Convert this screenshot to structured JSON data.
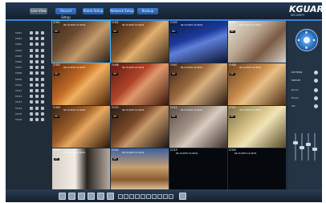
{
  "brand": {
    "logo": "KGUARD",
    "tagline": "SECURITY"
  },
  "tabs": [
    {
      "label": "Live View",
      "active": true
    },
    {
      "label": "Record Setup",
      "active": false
    },
    {
      "label": "Alarm Setup",
      "active": false
    },
    {
      "label": "Network Setup",
      "active": false
    },
    {
      "label": "Backup",
      "active": false
    }
  ],
  "channels": [
    "CH01",
    "CH02",
    "CH03",
    "CH04",
    "CH05",
    "CH06",
    "CH07",
    "CH08",
    "CH09",
    "CH10",
    "CH11",
    "CH12",
    "CH13",
    "CH14",
    "CH15",
    "CH16"
  ],
  "cells": [
    {
      "name": "CH01",
      "time": "06-13-2015 14:40:01",
      "tag": "REC",
      "bg": "linear-gradient(135deg,#3a2a1e 0%,#6b4a30 35%,#c59a6b 60%,#2a1d15 100%)"
    },
    {
      "name": "CH02",
      "time": "06-13-2015 14:40:01",
      "tag": "REC",
      "bg": "linear-gradient(135deg,#2a1a10 0%,#8a5a2e 40%,#e2b070 55%,#3a2414 100%)"
    },
    {
      "name": "CH03",
      "time": "06-13-2015 14:40:01",
      "tag": "REC",
      "bg": "linear-gradient(160deg,#0b1a4a 0%,#1b3a9a 40%,#5f7fd8 55%,#0a1430 100%)"
    },
    {
      "name": "CH04",
      "time": "06-13-2015 14:40:01",
      "tag": "REC",
      "bg": "linear-gradient(135deg,#e8e4dc 0%,#b9a48e 40%,#7a5a44 65%,#d8d2c8 100%)"
    },
    {
      "name": "CH05",
      "time": "06-13-2015 14:40:01",
      "tag": "REC",
      "bg": "linear-gradient(135deg,#5a2a10 0%,#c26a25 40%,#f0b060 55%,#4a2008 100%)"
    },
    {
      "name": "CH06",
      "time": "06-13-2015 14:40:01",
      "tag": "REC",
      "bg": "linear-gradient(135deg,#5a1a10 0%,#b0442a 40%,#e09a6a 55%,#3a120a 100%)"
    },
    {
      "name": "CH07",
      "time": "06-13-2015 14:40:01",
      "tag": "REC",
      "bg": "linear-gradient(135deg,#3a2418 0%,#9a6a3e 40%,#d8b080 55%,#2a1a10 100%)"
    },
    {
      "name": "CH08",
      "time": "06-13-2015 14:40:01",
      "tag": "REC",
      "bg": "linear-gradient(135deg,#6a4020 0%,#c58a4a 40%,#e8c088 55%,#4a2c14 100%)"
    },
    {
      "name": "CH09",
      "time": "06-13-2015 14:40:01",
      "tag": "REC",
      "bg": "linear-gradient(135deg,#3a2010 0%,#a0602a 40%,#e8a860 55%,#2a1608 100%)"
    },
    {
      "name": "CH10",
      "time": "06-13-2015 14:40:01",
      "tag": "REC",
      "bg": "linear-gradient(135deg,#2a1a12 0%,#7a4a2a 40%,#c89a6a 55%,#1e140e 100%)"
    },
    {
      "name": "CH11",
      "time": "06-13-2015 14:40:01",
      "tag": "REC",
      "bg": "linear-gradient(135deg,#5a4a44 0%,#a49488 40%,#d8ccc0 55%,#3a2e28 100%)"
    },
    {
      "name": "CH12",
      "time": "06-13-2015 14:40:01",
      "tag": "REC",
      "bg": "linear-gradient(135deg,#7a6a40 0%,#d8c488 40%,#f0e4b8 55%,#5a4a28 100%)"
    },
    {
      "name": "CH13",
      "time": "06-13-2015 14:40:01",
      "tag": "REC",
      "bg": "linear-gradient(90deg,#d8d0c8 0%,#f2ece4 40%,#2a2420 60%,#b8aca0 100%)"
    },
    {
      "name": "CH14",
      "time": "06-13-2015 14:40:01",
      "tag": "REC",
      "bg": "linear-gradient(180deg,#3a60a0 0%,#c8a070 45%,#8a5a30 75%,#e0c8a0 100%)"
    },
    {
      "name": "CH15",
      "time": "06-13-2015 14:40:01",
      "tag": "",
      "bg": "#05080c"
    },
    {
      "name": "CH16",
      "time": "06-13-2015 14:40:01",
      "tag": "",
      "bg": "#05080c"
    }
  ],
  "right": {
    "labels": [
      "PATTERN",
      "PRESET",
      "Zoom",
      "Focus",
      "Iris"
    ]
  }
}
